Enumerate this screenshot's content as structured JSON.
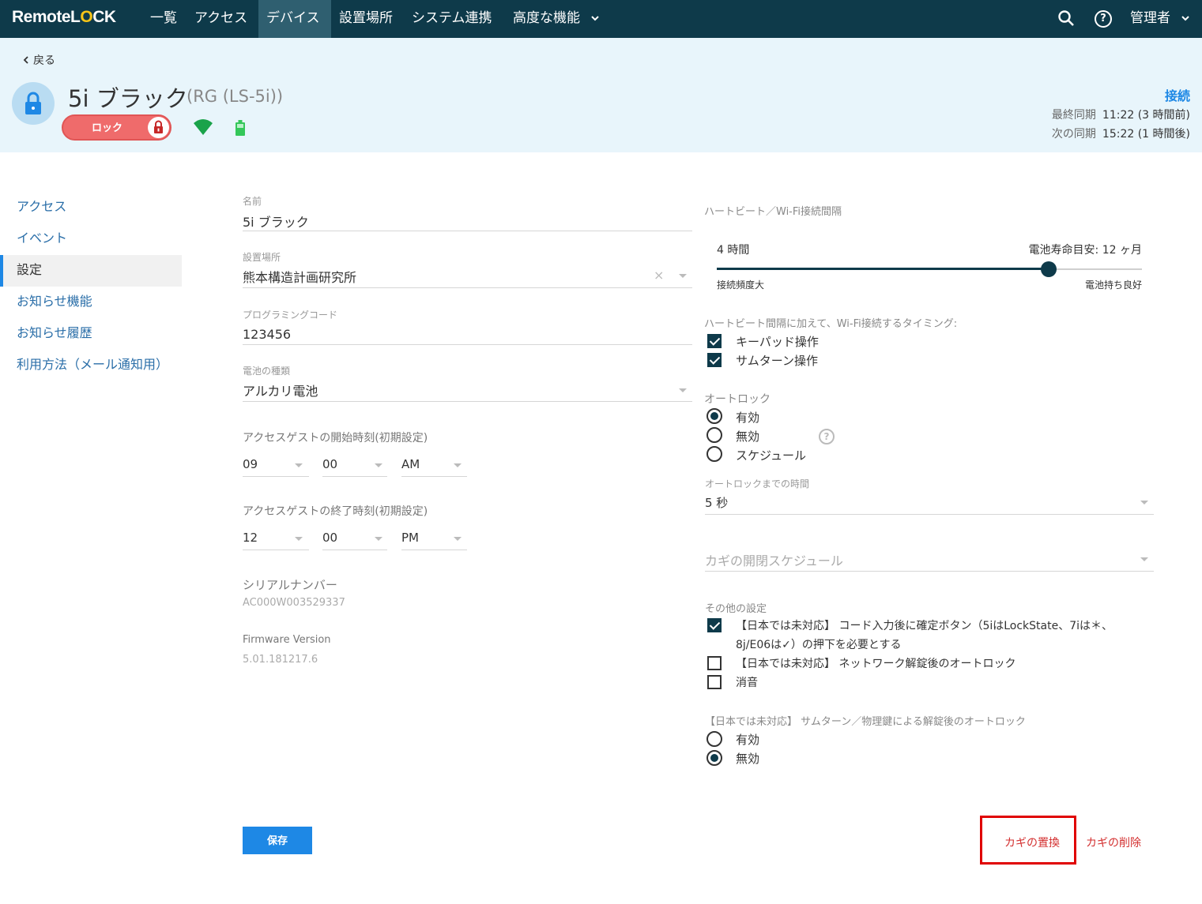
{
  "nav": {
    "logo_left": "Remote",
    "logo_l": "L",
    "logo_o": "O",
    "logo_right": "CK",
    "items": [
      "一覧",
      "アクセス",
      "デバイス",
      "設置場所",
      "システム連携",
      "高度な機能"
    ],
    "admin": "管理者"
  },
  "header": {
    "back": "戻る",
    "device_name": "5i ブラック",
    "device_model": "(RG (LS-5i))",
    "lock_state": "ロック",
    "connection": "接続",
    "last_sync_label": "最終同期",
    "last_sync_value": "11:22 (3 時間前)",
    "next_sync_label": "次の同期",
    "next_sync_value": "15:22 (1 時間後)"
  },
  "sidebar": {
    "items": [
      {
        "label": "アクセス"
      },
      {
        "label": "イベント"
      },
      {
        "label": "設定"
      },
      {
        "label": "お知らせ機能"
      },
      {
        "label": "お知らせ履歴"
      },
      {
        "label": "利用方法（メール通知用）"
      }
    ],
    "active": "設定"
  },
  "form": {
    "name_label": "名前",
    "name_value": "5i ブラック",
    "location_label": "設置場所",
    "location_value": "熊本構造計画研究所",
    "code_label": "プログラミングコード",
    "code_value": "123456",
    "battery_label": "電池の種類",
    "battery_value": "アルカリ電池",
    "start_label": "アクセスゲストの開始時刻(初期設定)",
    "start_hour": "09",
    "start_min": "00",
    "start_ampm": "AM",
    "end_label": "アクセスゲストの終了時刻(初期設定)",
    "end_hour": "12",
    "end_min": "00",
    "end_ampm": "PM",
    "serial_label": "シリアルナンバー",
    "serial_value": "AC000W003529337",
    "firmware_label": "Firmware Version",
    "firmware_value": "5.01.181217.6"
  },
  "heartbeat": {
    "label": "ハートビート／Wi-Fi接続間隔",
    "interval": "4 時間",
    "battery_life": "電池寿命目安: 12 ヶ月",
    "left_caption": "接続頻度大",
    "right_caption": "電池持ち良好",
    "slider_fraction": 0.78,
    "timing_label": "ハートビート間隔に加えて、Wi-Fi接続するタイミング:",
    "timing_options": [
      {
        "label": "キーパッド操作",
        "checked": true
      },
      {
        "label": "サムターン操作",
        "checked": true
      }
    ]
  },
  "autolock": {
    "label": "オートロック",
    "options": [
      {
        "label": "有効",
        "selected": true
      },
      {
        "label": "無効",
        "selected": false
      },
      {
        "label": "スケジュール",
        "selected": false
      }
    ],
    "help_icon": "?",
    "delay_label": "オートロックまでの時間",
    "delay_value": "5 秒",
    "schedule_placeholder": "カギの開閉スケジュール"
  },
  "other": {
    "label": "その他の設定",
    "opt1_line1": "【日本では未対応】 コード入力後に確定ボタン（5iはLockState、7iは＊、",
    "opt1_line2": "8j/E06は✓）の押下を必要とする",
    "opt1_checked": true,
    "opt2": "【日本では未対応】 ネットワーク解錠後のオートロック",
    "opt2_checked": false,
    "opt3": "消音",
    "opt3_checked": false,
    "thumb_label": "【日本では未対応】 サムターン／物理鍵による解錠後のオートロック",
    "thumb_options": [
      {
        "label": "有効",
        "selected": false
      },
      {
        "label": "無効",
        "selected": true
      }
    ]
  },
  "actions": {
    "save": "保存",
    "replace_key": "カギの置換",
    "delete_key": "カギの削除"
  },
  "colors": {
    "nav_bg": "#0e3a4a",
    "accent": "#1e88e5",
    "lock_red": "#ef6b6b",
    "danger": "#d32f2f"
  }
}
